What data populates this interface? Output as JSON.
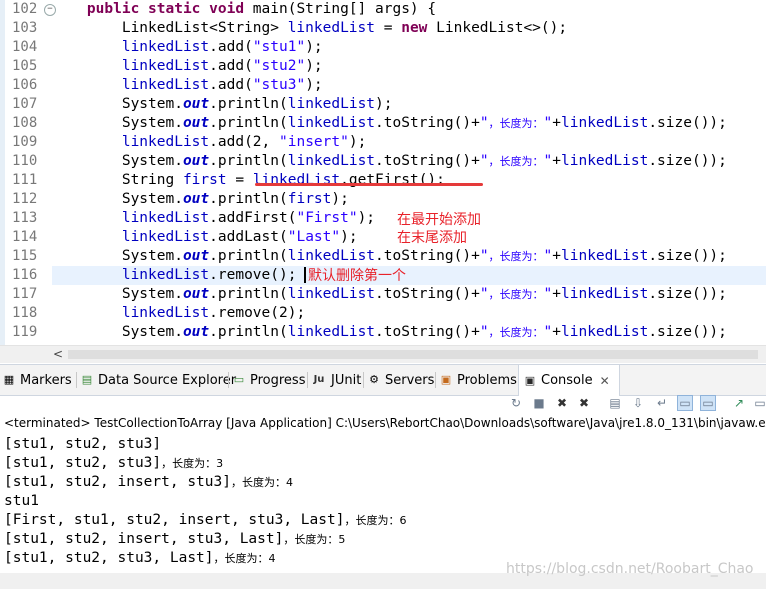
{
  "editor": {
    "line_numbers": [
      "102",
      "103",
      "104",
      "105",
      "106",
      "107",
      "108",
      "109",
      "110",
      "111",
      "112",
      "113",
      "114",
      "115",
      "116",
      "117",
      "118",
      "119"
    ],
    "annotations": {
      "add_note_1": "在最开始添加",
      "add_note_2": "在末尾添加",
      "remove_note": "默认删除第一个"
    },
    "accent_colors": {
      "keyword": "#7f0055",
      "field": "#0000c0",
      "string": "#2a00ff",
      "annotation": "#e8222a",
      "current_line": "#e8f2fe"
    }
  },
  "tabs": [
    {
      "label": "Markers",
      "icon": "markers-icon"
    },
    {
      "label": "Data Source Explorer",
      "icon": "data-source-icon"
    },
    {
      "label": "Progress",
      "icon": "progress-icon"
    },
    {
      "label": "JUnit",
      "icon": "junit-icon"
    },
    {
      "label": "Servers",
      "icon": "servers-icon"
    },
    {
      "label": "Problems",
      "icon": "problems-icon"
    },
    {
      "label": "Console",
      "icon": "console-icon",
      "active": true
    }
  ],
  "console": {
    "status": "<terminated> TestCollectionToArray [Java Application] C:\\Users\\RebortChao\\Downloads\\software\\Java\\jre1.8.0_131\\bin\\javaw.exe (",
    "lines": [
      {
        "text": "[stu1, stu2, stu3]",
        "cn": ""
      },
      {
        "text": "[stu1, stu2, stu3]",
        "cn": "，长度为：3"
      },
      {
        "text": "[stu1, stu2, insert, stu3]",
        "cn": "，长度为：4"
      },
      {
        "text": "stu1",
        "cn": ""
      },
      {
        "text": "[First, stu1, stu2, insert, stu3, Last]",
        "cn": "，长度为：6"
      },
      {
        "text": "[stu1, stu2, insert, stu3, Last]",
        "cn": "，长度为：5"
      },
      {
        "text": "[stu1, stu2, stu3, Last]",
        "cn": "，长度为：4"
      }
    ]
  },
  "watermark": "https://blog.csdn.net/Roobart_Chao"
}
